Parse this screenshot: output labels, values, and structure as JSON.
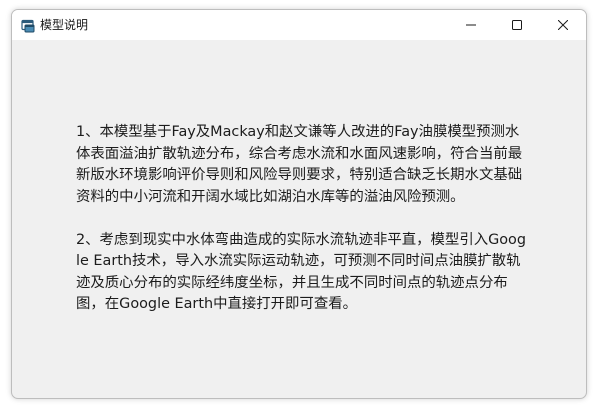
{
  "window": {
    "title": "模型说明",
    "app_icon": "app-window-icon",
    "buttons": {
      "minimize_icon": "minimize-icon",
      "maximize_icon": "maximize-icon",
      "close_icon": "close-icon"
    }
  },
  "content": {
    "paragraphs": [
      "1、本模型基于Fay及Mackay和赵文谦等人改进的Fay油膜模型预测水体表面溢油扩散轨迹分布，综合考虑水流和水面风速影响，符合当前最新版水环境影响评价导则和风险导则要求，特别适合缺乏长期水文基础资料的中小河流和开阔水域比如湖泊水库等的溢油风险预测。",
      "2、考虑到现实中水体弯曲造成的实际水流轨迹非平直，模型引入Google Earth技术，导入水流实际运动轨迹，可预测不同时间点油膜扩散轨迹及质心分布的实际经纬度坐标，并且生成不同时间点的轨迹点分布图，在Google Earth中直接打开即可查看。"
    ]
  },
  "colors": {
    "titlebar": "#ffffff",
    "client_area": "#f0f0f0",
    "text": "#1c1c1c"
  }
}
